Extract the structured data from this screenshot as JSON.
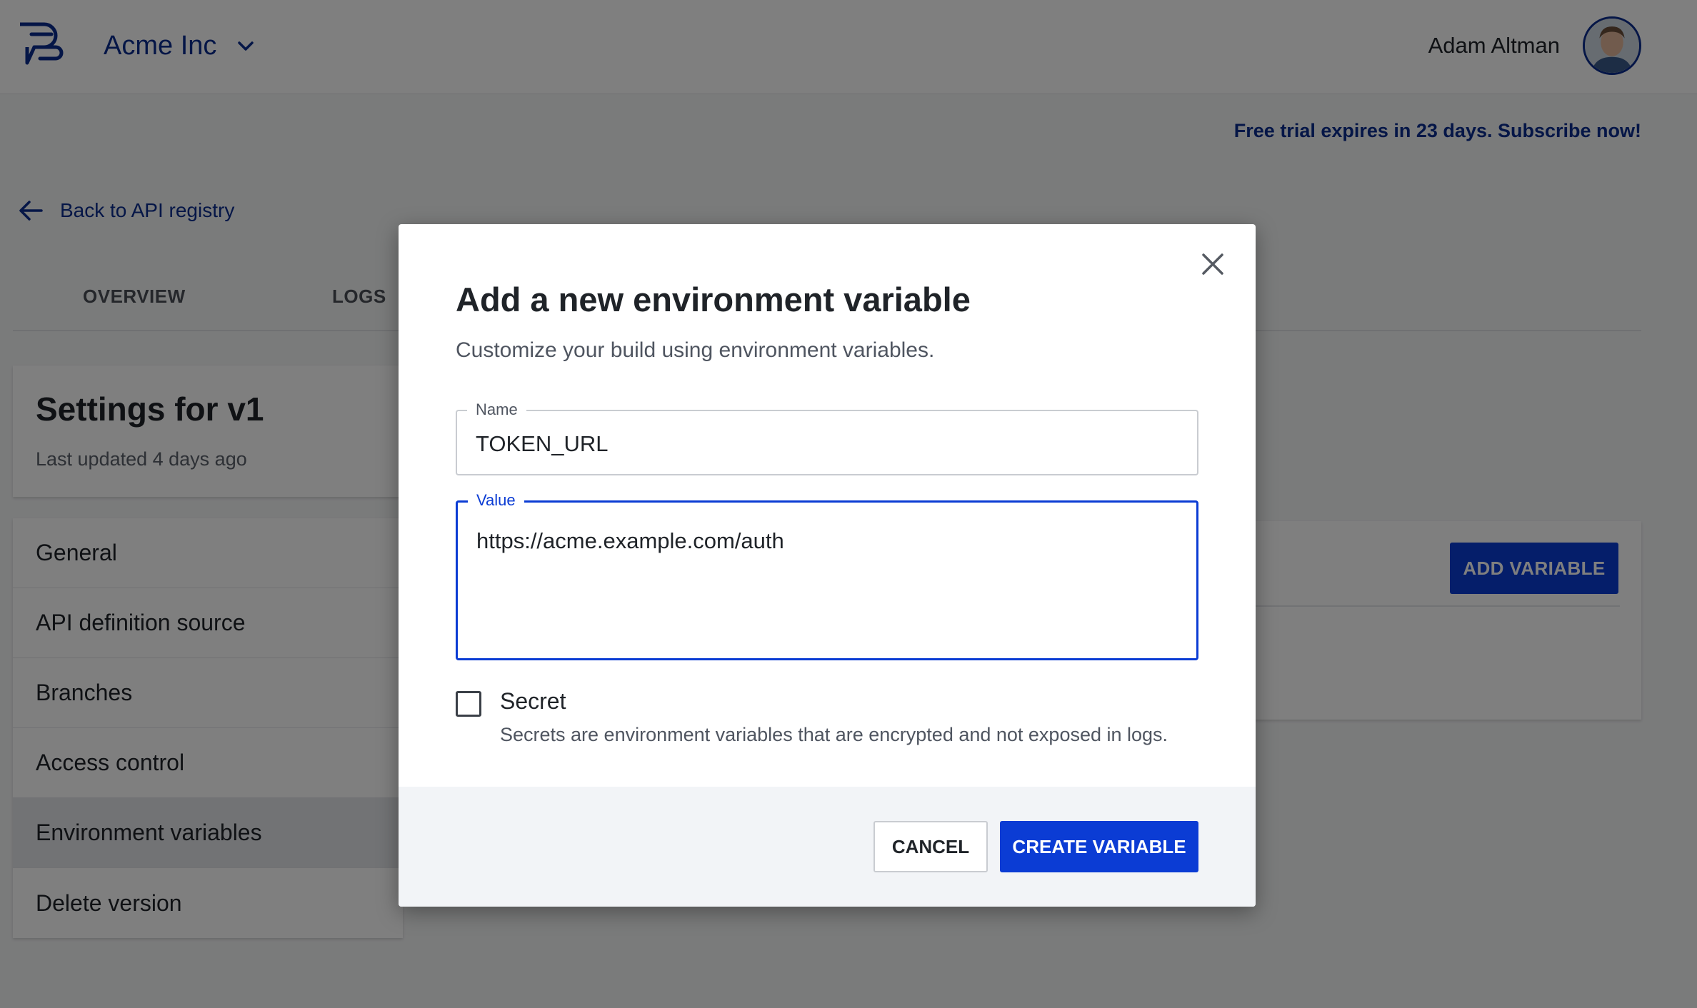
{
  "header": {
    "org_name": "Acme Inc",
    "user_name": "Adam Altman"
  },
  "trial_banner": "Free trial expires in 23 days. Subscribe now!",
  "back_link": "Back to API registry",
  "tabs": [
    {
      "label": "OVERVIEW"
    },
    {
      "label": "LOGS"
    }
  ],
  "settings": {
    "title": "Settings for v1",
    "subtitle": "Last updated 4 days ago"
  },
  "menu": {
    "items": [
      {
        "label": "General"
      },
      {
        "label": "API definition source"
      },
      {
        "label": "Branches"
      },
      {
        "label": "Access control"
      },
      {
        "label": "Environment variables",
        "active": true
      },
      {
        "label": "Delete version"
      }
    ]
  },
  "env_card": {
    "add_button": "ADD VARIABLE"
  },
  "modal": {
    "title": "Add a new environment variable",
    "subtitle": "Customize your build using environment variables.",
    "name_label": "Name",
    "name_value": "TOKEN_URL",
    "value_label": "Value",
    "value_value": "https://acme.example.com/auth",
    "secret_label": "Secret",
    "secret_checked": false,
    "secret_help": "Secrets are environment variables that are encrypted and not exposed in logs.",
    "cancel_label": "CANCEL",
    "create_label": "CREATE VARIABLE"
  },
  "colors": {
    "brand": "#0a2d8f",
    "primary": "#0b3cd4"
  },
  "icons": {
    "logo": "acme-logo-icon",
    "chevron": "chevron-down-icon",
    "back": "arrow-left-icon",
    "close": "close-icon"
  }
}
